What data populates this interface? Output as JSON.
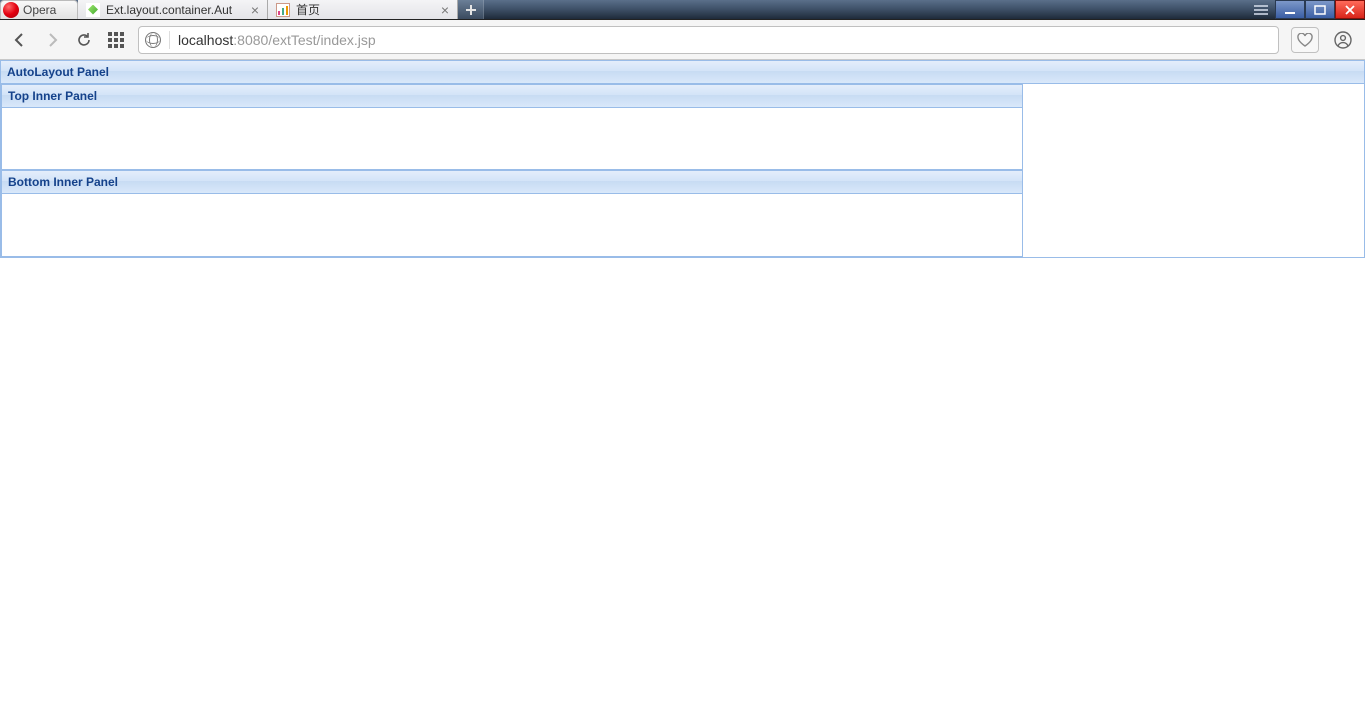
{
  "browser": {
    "opera_label": "Opera",
    "tabs": [
      {
        "label": "Ext.layout.container.Aut"
      },
      {
        "label": "首页"
      }
    ],
    "url_host": "localhost",
    "url_port": ":8080",
    "url_path": "/extTest/index.jsp"
  },
  "panel": {
    "outer_title": "AutoLayout Panel",
    "inner_top_title": "Top Inner Panel",
    "inner_bottom_title": "Bottom Inner Panel"
  }
}
